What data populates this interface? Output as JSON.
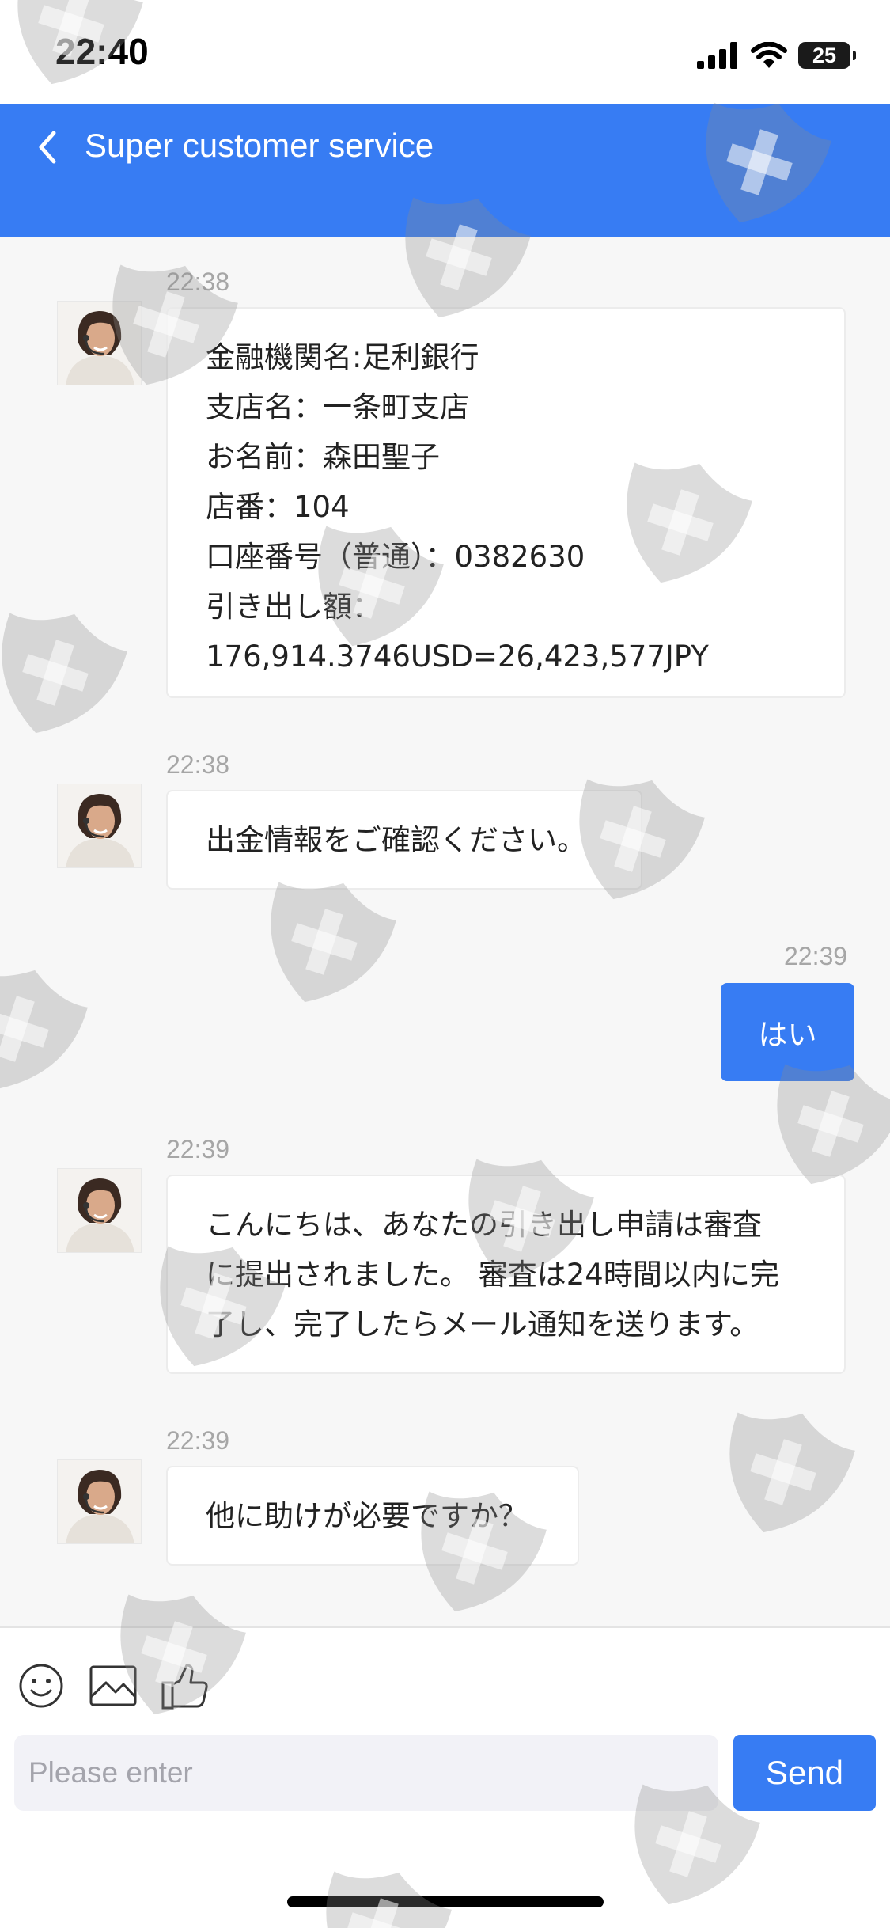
{
  "status_bar": {
    "time": "22:40",
    "battery": "25",
    "icons": [
      "signal-icon",
      "wifi-icon",
      "battery-icon"
    ]
  },
  "header": {
    "title": "Super customer service",
    "back_icon": "chevron-left-icon"
  },
  "colors": {
    "accent": "#377cf3",
    "background": "#f7f7f7",
    "bubble": "#ffffff",
    "timestamp": "#a6a6a6"
  },
  "messages": [
    {
      "sender": "agent",
      "time": "22:38",
      "lines": [
        "金融機関名:足利銀行",
        "支店名：一条町支店",
        "お名前：森田聖子",
        "店番：104",
        "口座番号（普通）：0382630",
        "引き出し額：",
        "176,914.3746USD=26,423,577JPY"
      ]
    },
    {
      "sender": "agent",
      "time": "22:38",
      "lines": [
        "出金情報をご確認ください。"
      ]
    },
    {
      "sender": "me",
      "time": "22:39",
      "lines": [
        "はい"
      ]
    },
    {
      "sender": "agent",
      "time": "22:39",
      "lines": [
        "こんにちは、あなたの引き出し申請は審査",
        "に提出されました。 審査は24時間以内に完",
        "了し、完了したらメール通知を送ります。"
      ]
    },
    {
      "sender": "agent",
      "time": "22:39",
      "lines": [
        "他に助けが必要ですか？"
      ]
    }
  ],
  "composer": {
    "placeholder": "Please enter",
    "value": "",
    "send_label": "Send",
    "tools": [
      "emoji-icon",
      "image-icon",
      "thumbs-up-icon"
    ]
  }
}
